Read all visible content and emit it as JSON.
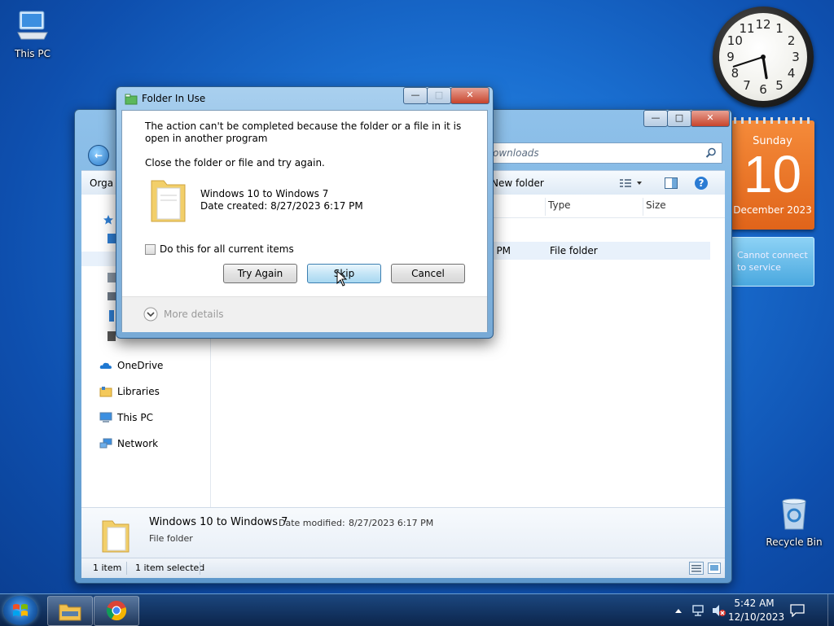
{
  "desktop": {
    "icons": [
      {
        "label": "This PC",
        "icon": "computer-icon"
      },
      {
        "label": "Recycle Bin",
        "icon": "recycle-bin-icon"
      }
    ]
  },
  "gadgets": {
    "clock": {
      "numerals": [
        "12",
        "1",
        "2",
        "3",
        "4",
        "5",
        "6",
        "7",
        "8",
        "9",
        "10",
        "11"
      ],
      "time": "5:42"
    },
    "calendar": {
      "weekday": "Sunday",
      "day": "10",
      "month_year": "December 2023"
    },
    "weather": {
      "message": "Cannot connect to service"
    }
  },
  "explorer": {
    "address_text": "ownloads",
    "toolbar": {
      "organize_label": "Orga",
      "new_folder_label": "New folder"
    },
    "columns": [
      {
        "label": "d"
      },
      {
        "label": "Type"
      },
      {
        "label": "Size"
      }
    ],
    "row": {
      "date_fragment": "7 PM",
      "type": "File folder"
    },
    "nav": [
      {
        "label": "OneDrive",
        "icon": "onedrive-icon"
      },
      {
        "label": "Libraries",
        "icon": "libraries-icon"
      },
      {
        "label": "This PC",
        "icon": "this-pc-icon"
      },
      {
        "label": "Network",
        "icon": "network-icon"
      }
    ],
    "details": {
      "name": "Windows 10 to Windows 7",
      "date_label": "Date modified:",
      "date_value": "8/27/2023 6:17 PM",
      "kind": "File folder"
    },
    "status": {
      "count": "1 item",
      "selected": "1 item selected"
    }
  },
  "dialog": {
    "title": "Folder In Use",
    "message": "The action can't be completed because the folder or a file in it is open in another program",
    "instruction": "Close the folder or file and try again.",
    "item": {
      "name": "Windows 10 to Windows 7",
      "date": "Date created: 8/27/2023 6:17 PM"
    },
    "checkbox_label": "Do this for all current items",
    "buttons": {
      "try_again": "Try Again",
      "skip": "Skip",
      "cancel": "Cancel"
    },
    "more_details": "More details"
  },
  "taskbar": {
    "apps": [
      {
        "name": "file-explorer",
        "icon": "folder-icon"
      },
      {
        "name": "chrome",
        "icon": "chrome-icon"
      }
    ],
    "time": "5:42 AM",
    "date": "12/10/2023"
  }
}
